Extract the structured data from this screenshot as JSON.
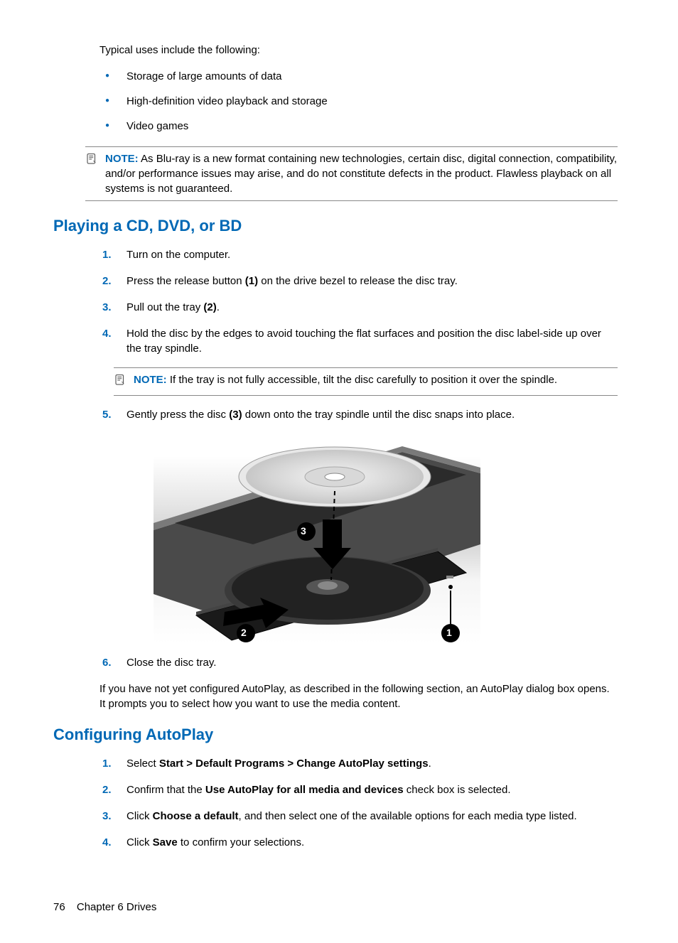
{
  "intro": "Typical uses include the following:",
  "bullets": [
    "Storage of large amounts of data",
    "High-definition video playback and storage",
    "Video games"
  ],
  "note1": {
    "label": "NOTE:",
    "text": "As Blu-ray is a new format containing new technologies, certain disc, digital connection, compatibility, and/or performance issues may arise, and do not constitute defects in the product. Flawless playback on all systems is not guaranteed."
  },
  "section1": {
    "heading": "Playing a CD, DVD, or BD",
    "steps": [
      {
        "pre": "Turn on the computer."
      },
      {
        "pre": "Press the release button ",
        "b1": "(1)",
        "post": " on the drive bezel to release the disc tray."
      },
      {
        "pre": "Pull out the tray ",
        "b1": "(2)",
        "post": "."
      },
      {
        "pre": "Hold the disc by the edges to avoid touching the flat surfaces and position the disc label-side up over the tray spindle."
      },
      {
        "pre": "Gently press the disc ",
        "b1": "(3)",
        "post": " down onto the tray spindle until the disc snaps into place."
      },
      {
        "pre": "Close the disc tray."
      }
    ],
    "innerNote": {
      "label": "NOTE:",
      "text": "If the tray is not fully accessible, tilt the disc carefully to position it over the spindle."
    },
    "after": "If you have not yet configured AutoPlay, as described in the following section, an AutoPlay dialog box opens. It prompts you to select how you want to use the media content."
  },
  "section2": {
    "heading": "Configuring AutoPlay",
    "steps": [
      {
        "pre": "Select ",
        "b1": "Start > Default Programs > Change AutoPlay settings",
        "post": "."
      },
      {
        "pre": "Confirm that the ",
        "b1": "Use AutoPlay for all media and devices",
        "post": " check box is selected."
      },
      {
        "pre": "Click ",
        "b1": "Choose a default",
        "post": ", and then select one of the available options for each media type listed."
      },
      {
        "pre": "Click ",
        "b1": "Save",
        "post": " to confirm your selections."
      }
    ]
  },
  "footer": {
    "page": "76",
    "chapter": "Chapter 6   Drives"
  },
  "callouts": {
    "c1": "1",
    "c2": "2",
    "c3": "3"
  }
}
